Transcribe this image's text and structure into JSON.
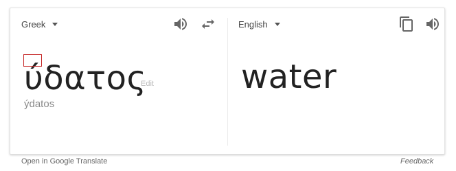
{
  "source": {
    "language": "Greek",
    "text": "ύδατος",
    "edit_label": "Edit",
    "transliteration": "ýdatos"
  },
  "target": {
    "language": "English",
    "text": "water"
  },
  "icons": {
    "speaker": "speaker-icon",
    "swap": "swap-languages-icon",
    "copy": "copy-icon"
  },
  "footer": {
    "open_link": "Open in Google Translate",
    "feedback": "Feedback"
  },
  "colors": {
    "highlight_box": "#c62828",
    "icon": "#666666"
  }
}
